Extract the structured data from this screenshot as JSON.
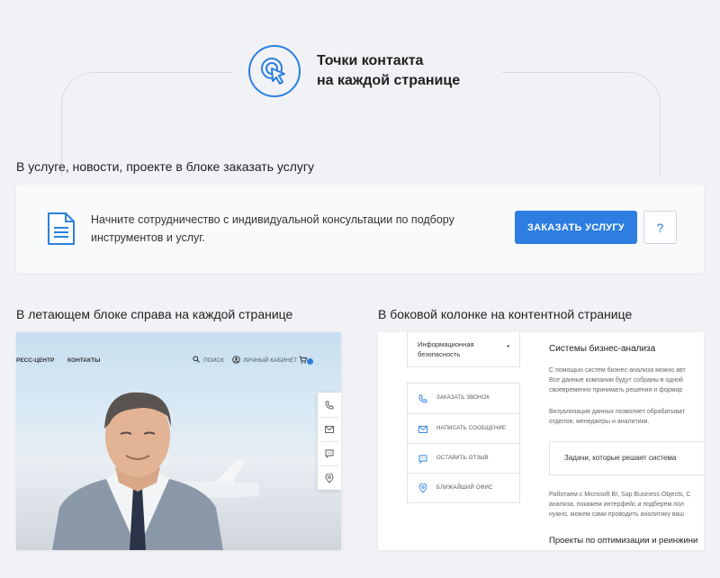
{
  "header": {
    "title_line1": "Точки контакта",
    "title_line2": "на каждой странице",
    "icon": "cursor-click-icon",
    "accent_color": "#2b80df"
  },
  "section1": {
    "label": "В услуге, новости, проекте в блоке заказать услугу",
    "text_line1": "Начните сотрудничество с индивидуальной консультации по подбору",
    "text_line2": "инструментов и услуг.",
    "order_button": "ЗАКАЗАТЬ УСЛУГУ",
    "help_button": "?",
    "icon": "document-icon"
  },
  "section2": {
    "label": "В летающем блоке справа на каждой странице",
    "nav": {
      "press": "РЕСС-ЦЕНТР",
      "contacts": "КОНТАКТЫ",
      "search": "ПОИСК",
      "account": "ЛИЧНЫЙ КАБИНЕТ",
      "cart_icon": "cart-icon"
    },
    "float_icons": [
      "phone-icon",
      "mail-icon",
      "chat-icon",
      "location-pin-icon"
    ]
  },
  "section3": {
    "label": "В боковой колонке на контентной странице",
    "info_item_line1": "Информационная",
    "info_item_line2": "безопасность",
    "contacts": [
      {
        "icon": "phone-icon",
        "label": "ЗАКАЗАТЬ ЗВОНОК"
      },
      {
        "icon": "mail-icon",
        "label": "НАПИСАТЬ СООБЩЕНИЕ"
      },
      {
        "icon": "chat-icon",
        "label": "ОСТАВИТЬ ОТЗЫВ"
      },
      {
        "icon": "location-pin-icon",
        "label": "БЛИЖАЙШИЙ ОФИС"
      }
    ],
    "content_title": "Системы бизнес-анализа",
    "para1": [
      "С помощью систем бизнес-анализа можно авт",
      "Все данные компании будут собраны в одной",
      "своевременно принимать решения и формир"
    ],
    "para2": [
      "Визуализация данных позволяет обрабатыват",
      "отделов, менеджеры и аналитики."
    ],
    "tasks_box": "Задачи, которые решает система",
    "para3": [
      "Работаем с Microsoft BI, Sap Business Objects, C",
      "анализа, покажем интерфейс и подберем пол",
      "нужно, можем сами проводить аналитику ваш"
    ],
    "content_title2": "Проекты по оптимизации и реинжини"
  }
}
